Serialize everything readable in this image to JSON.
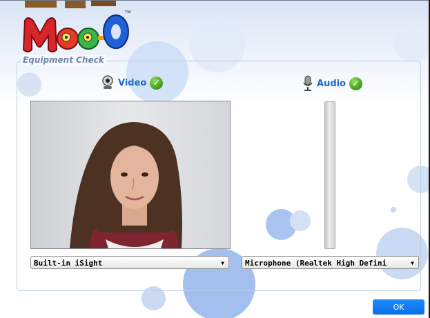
{
  "logo": {
    "text": "Moo-O",
    "trademark": "™"
  },
  "panel": {
    "title": "Equipment Check"
  },
  "video": {
    "label": "Video",
    "status_icon": "check-icon",
    "camera": "Built-in iSight"
  },
  "audio": {
    "label": "Audio",
    "status_icon": "check-icon",
    "microphone": "Microphone (Realtek High Defini",
    "level": 0
  },
  "ok_label": "OK",
  "colors": {
    "accent": "#1d6acb",
    "ok_button": "#0b6ee6",
    "panel_title": "#6f86ad",
    "check": "#3f9a17"
  }
}
